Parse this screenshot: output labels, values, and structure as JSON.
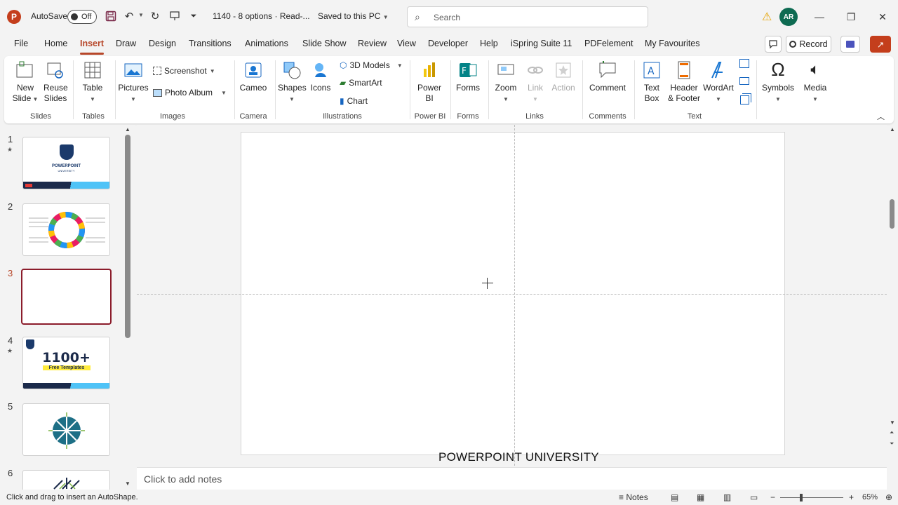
{
  "title_bar": {
    "app_logo": "P",
    "autosave_label": "AutoSave",
    "autosave_state": "Off",
    "doc_title": "1140 - 8 options  ·  Read-...",
    "saved_status": "Saved to this PC",
    "search_placeholder": "Search",
    "avatar_initials": "AR",
    "icons": [
      "save-icon",
      "undo-icon",
      "redo-icon",
      "present-icon",
      "customize-qat-icon",
      "warning-icon"
    ]
  },
  "menu": {
    "tabs": [
      "File",
      "Home",
      "Insert",
      "Draw",
      "Design",
      "Transitions",
      "Animations",
      "Slide Show",
      "Review",
      "View",
      "Developer",
      "Help",
      "iSpring Suite 11",
      "PDFelement",
      "My Favourites"
    ],
    "active_tab": "Insert",
    "record_label": "Record"
  },
  "ribbon": {
    "slides": {
      "new_slide": "New\nSlide",
      "reuse_slides": "Reuse\nSlides",
      "label": "Slides"
    },
    "tables": {
      "table": "Table",
      "label": "Tables"
    },
    "images": {
      "pictures": "Pictures",
      "screenshot": "Screenshot",
      "photo_album": "Photo Album",
      "label": "Images"
    },
    "camera": {
      "cameo": "Cameo",
      "label": "Camera"
    },
    "illustrations": {
      "shapes": "Shapes",
      "icons": "Icons",
      "models": "3D Models",
      "smartart": "SmartArt",
      "chart": "Chart",
      "label": "Illustrations"
    },
    "powerbi": {
      "power_bi": "Power\nBI",
      "label": "Power BI"
    },
    "forms": {
      "forms": "Forms",
      "label": "Forms"
    },
    "links": {
      "zoom": "Zoom",
      "link": "Link",
      "action": "Action",
      "label": "Links"
    },
    "comments": {
      "comment": "Comment",
      "label": "Comments"
    },
    "text": {
      "text_box": "Text\nBox",
      "header_footer": "Header\n& Footer",
      "wordart": "WordArt",
      "label": "Text"
    },
    "symbols": {
      "symbols": "Symbols"
    },
    "media": {
      "media": "Media"
    }
  },
  "thumbnails": [
    {
      "num": "1",
      "starred": true,
      "title": "POWERPOINT",
      "subtitle": "UNIVERSITY"
    },
    {
      "num": "2",
      "starred": false
    },
    {
      "num": "3",
      "starred": false,
      "selected": true
    },
    {
      "num": "4",
      "starred": true,
      "title": "1100+",
      "subtitle": "Free Templates"
    },
    {
      "num": "5",
      "starred": false
    },
    {
      "num": "6",
      "starred": false
    }
  ],
  "slide": {
    "watermark": "POWERPOINT UNIVERSITY"
  },
  "notes": {
    "placeholder": "Click to add notes"
  },
  "status_bar": {
    "hint": "Click and drag to insert an AutoShape.",
    "notes_label": "Notes",
    "zoom_level": "65%"
  },
  "colors": {
    "accent": "#b7472a",
    "selected_thumb_border": "#8b1c2b",
    "avatar_bg": "#0e6b52"
  }
}
